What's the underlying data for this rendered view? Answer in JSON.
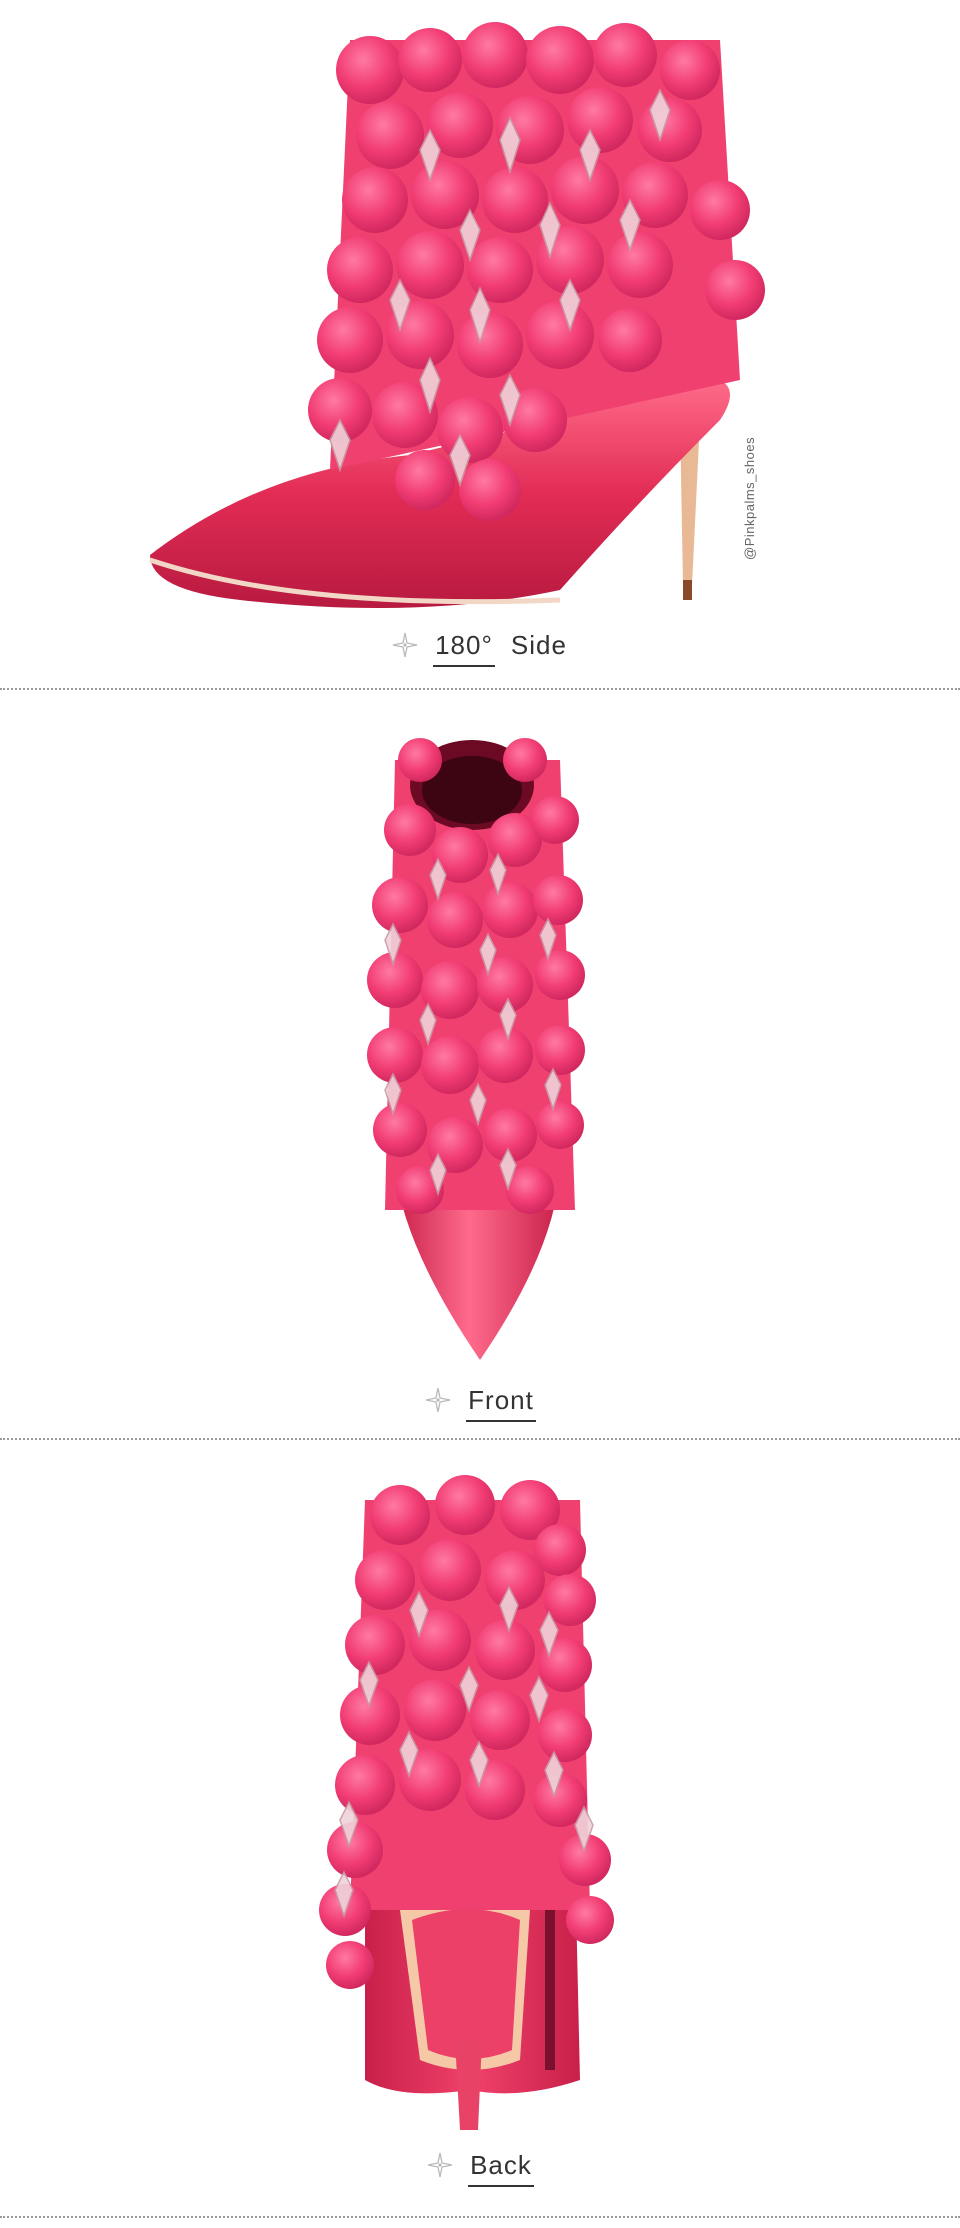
{
  "sections": [
    {
      "view_label_a": "180°",
      "view_label_b": "Side"
    },
    {
      "view_label_a": "",
      "view_label_b": "Front"
    },
    {
      "view_label_a": "",
      "view_label_b": "Back"
    }
  ],
  "watermark": "@Pinkpalms_shoes",
  "colors": {
    "satin": "#e8315a",
    "pompom": "#f2467a",
    "crystal": "#e9c6cf",
    "divider": "#9a9a9a",
    "text": "#333333"
  }
}
